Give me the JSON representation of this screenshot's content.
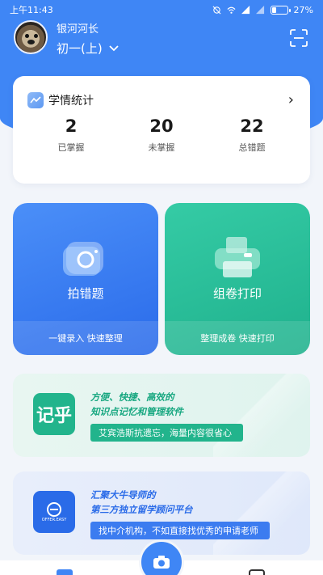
{
  "status_bar": {
    "time": "上午11:43",
    "battery": "27%",
    "battery_level": 0.27
  },
  "user": {
    "name": "银河河长",
    "grade": "初一(上)"
  },
  "stats": {
    "title": "学情统计",
    "items": [
      {
        "value": "2",
        "label": "已掌握"
      },
      {
        "value": "20",
        "label": "未掌握"
      },
      {
        "value": "22",
        "label": "总错题"
      }
    ]
  },
  "features": [
    {
      "title": "拍错题",
      "subtitle": "一键录入 快速整理",
      "icon": "camera-icon"
    },
    {
      "title": "组卷打印",
      "subtitle": "整理成卷 快速打印",
      "icon": "printer-icon"
    }
  ],
  "banners": [
    {
      "logo_text": "记乎",
      "headline_line1": "方便、快捷、高效的",
      "headline_line2": "知识点记忆和管理软件",
      "pill": "艾宾浩斯抗遗忘，海量内容很省心"
    },
    {
      "logo_text": "OFFER.EASY",
      "headline_line1": "汇聚大牛导师的",
      "headline_line2": "第三方独立留学顾问平台",
      "pill": "找中介机构，不如直接找优秀的申请老师"
    }
  ],
  "colors": {
    "primary": "#3f86f5",
    "green": "#22b48c",
    "background": "#f2f5fa"
  }
}
